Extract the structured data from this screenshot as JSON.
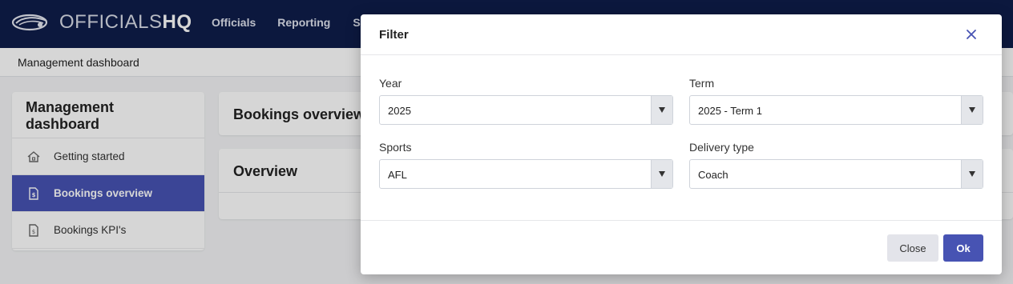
{
  "app": {
    "logo_light": "OFFICIALS",
    "logo_bold": "HQ"
  },
  "nav": {
    "items": [
      "Officials",
      "Reporting",
      "Sch"
    ]
  },
  "breadcrumb": "Management dashboard",
  "sidebar": {
    "title": "Management dashboard",
    "items": [
      {
        "label": "Getting started",
        "icon": "home-icon"
      },
      {
        "label": "Bookings overview",
        "icon": "document-dollar-icon",
        "active": true
      },
      {
        "label": "Bookings KPI's",
        "icon": "document-dollar-icon"
      }
    ]
  },
  "main": {
    "cards": [
      {
        "title": "Bookings overview"
      },
      {
        "title": "Overview"
      }
    ]
  },
  "modal": {
    "title": "Filter",
    "fields": {
      "year": {
        "label": "Year",
        "value": "2025"
      },
      "term": {
        "label": "Term",
        "value": "2025 - Term 1"
      },
      "sports": {
        "label": "Sports",
        "value": "AFL"
      },
      "delivery": {
        "label": "Delivery type",
        "value": "Coach"
      }
    },
    "buttons": {
      "close": "Close",
      "ok": "Ok"
    }
  },
  "colors": {
    "nav_bg": "#0f1d4a",
    "accent": "#4753b3"
  }
}
